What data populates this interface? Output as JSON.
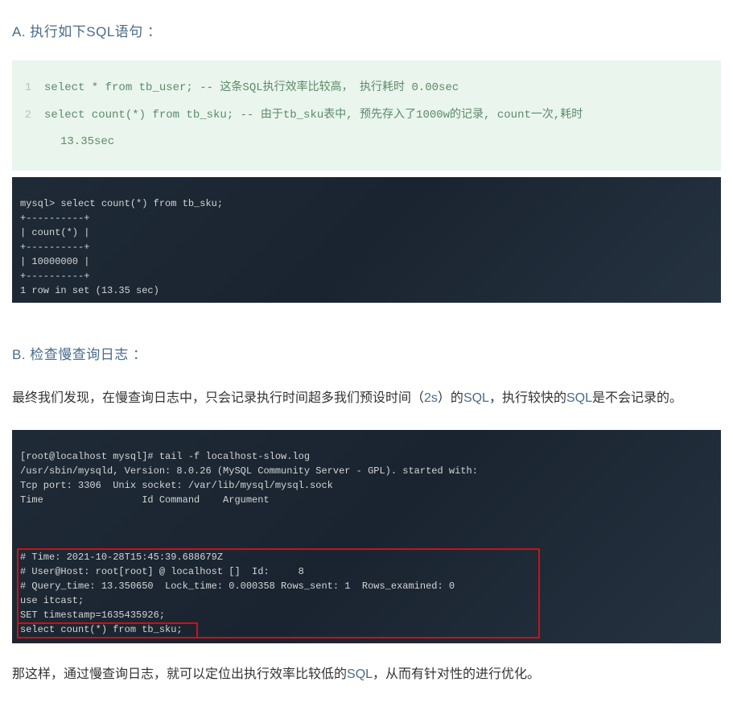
{
  "section_a": {
    "label": "A. 执行如下SQL语句 ："
  },
  "code": {
    "line1": {
      "num": "1",
      "text": "select * from tb_user; -- 这条SQL执行效率比较高， 执行耗时 0.00sec"
    },
    "line2": {
      "num": "2",
      "text": "select count(*) from tb_sku; -- 由于tb_sku表中, 预先存入了1000w的记录, count一次,耗时"
    },
    "line2_wrap": "13.35sec"
  },
  "terminal1": {
    "l1": "mysql> select count(*) from tb_sku;",
    "l2": "+----------+",
    "l3": "| count(*) |",
    "l4": "+----------+",
    "l5": "| 10000000 |",
    "l6": "+----------+",
    "l7": "1 row in set (13.35 sec)"
  },
  "section_b": {
    "label": "B. 检查慢查询日志 ："
  },
  "para1": {
    "text_pre": "最终我们发现，在慢查询日志中，只会记录执行时间超多我们预设时间（",
    "time": "2s",
    "text_mid": "）的",
    "sql": "SQL",
    "text_mid2": "，执行较快的",
    "sql2": "SQL",
    "text_post": "是不会记录的。"
  },
  "terminal2": {
    "l1": "[root@localhost mysql]# tail -f localhost-slow.log",
    "l2": "/usr/sbin/mysqld, Version: 8.0.26 (MySQL Community Server - GPL). started with:",
    "l3": "Tcp port: 3306  Unix socket: /var/lib/mysql/mysql.sock",
    "l4": "Time                 Id Command    Argument",
    "b1": "# Time: 2021-10-28T15:45:39.688679Z",
    "b2": "# User@Host: root[root] @ localhost []  Id:     8",
    "b3": "# Query_time: 13.350650  Lock_time: 0.000358 Rows_sent: 1  Rows_examined: 0",
    "b4": "use itcast;",
    "b5": "SET timestamp=1635435926;",
    "b6": "select count(*) from tb_sku;"
  },
  "para2": {
    "text_pre": "那这样，通过慢查询日志，就可以定位出执行效率比较低的",
    "sql": "SQL",
    "text_post": "，从而有针对性的进行优化。"
  }
}
